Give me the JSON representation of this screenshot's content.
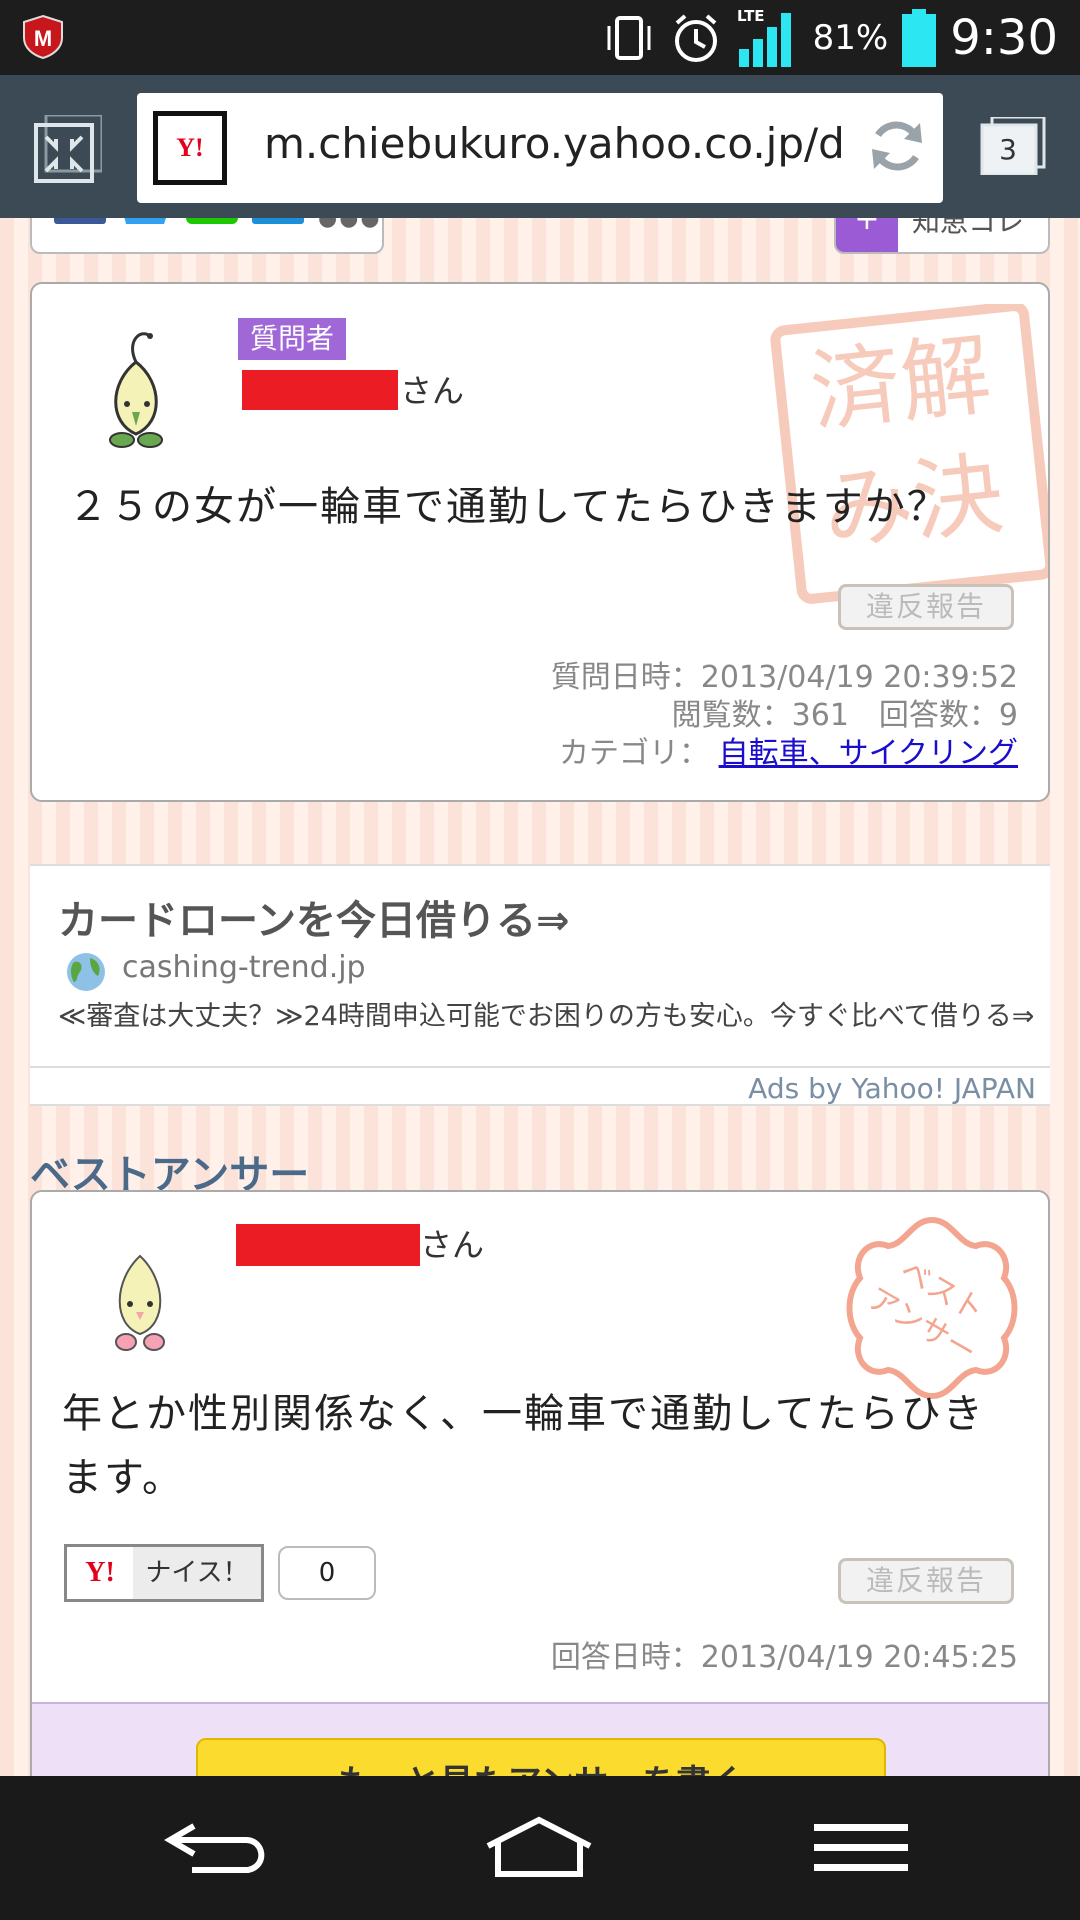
{
  "status_bar": {
    "network": "LTE",
    "battery_percent": "81%",
    "time": "9:30",
    "icons": [
      "mcafee-icon",
      "vibrate-icon",
      "alarm-icon",
      "signal-icon",
      "battery-icon"
    ]
  },
  "browser": {
    "url": "m.chiebukuro.yahoo.co.jp/d",
    "favicon_text": "Y!",
    "tab_count": "3"
  },
  "share_bar": {
    "tab_label": "知恵コレ",
    "badge": "+"
  },
  "question": {
    "badge": "質問者",
    "name_suffix": "さん",
    "title": "２５の女が一輪車で通勤してたらひきますか？",
    "report_button": "違反報告",
    "date_line": "質問日時：2013/04/19 20:39:52",
    "stats_line": "閲覧数：361　回答数：9",
    "category_label": "カテゴリ：",
    "category_link": "自転車、サイクリング",
    "stamp": "解決済み"
  },
  "ad": {
    "title": "カードローンを今日借りる⇒",
    "domain": "cashing-trend.jp",
    "description": "≪審査は大丈夫？≫24時間申込可能でお困りの方も安心。今すぐ比べて借りる⇒",
    "credit": "Ads by Yahoo! JAPAN"
  },
  "best_answer": {
    "heading": "ベストアンサー",
    "name_suffix": "さん",
    "text": "年とか性別関係なく、一輪車で通勤してたらひきます。",
    "nice_label": "ナイス！",
    "nice_count": "0",
    "report_button": "違反報告",
    "date_line": "回答日時：2013/04/19 20:45:25",
    "stamp": "ベストアンサー",
    "write_button": "もっと見たアンサーを書く"
  },
  "colors": {
    "accent_purple": "#a067d6",
    "link_blue": "#1a0dcc",
    "redaction": "#ec1c24",
    "stamp_red": "#f3a58f"
  }
}
